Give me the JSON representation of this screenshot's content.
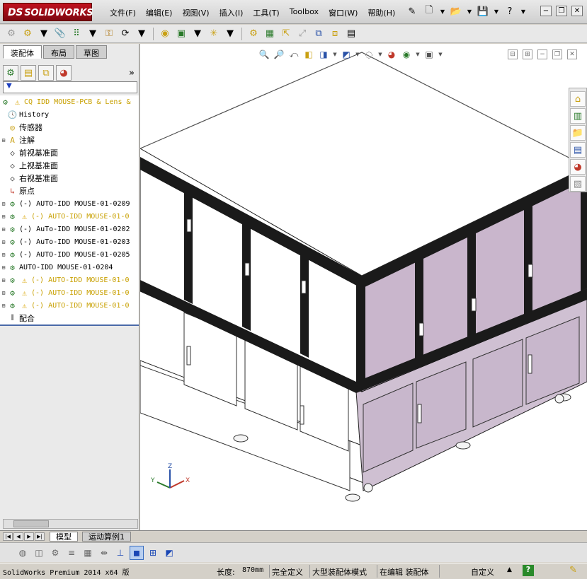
{
  "app": {
    "logo_prefix": "DS",
    "logo_text": "SOLIDWORKS"
  },
  "menu": [
    "文件(F)",
    "编辑(E)",
    "视图(V)",
    "插入(I)",
    "工具(T)",
    "Toolbox",
    "窗口(W)",
    "帮助(H)"
  ],
  "title_toolbar_icons": [
    "pin-icon",
    "new-document-icon",
    "open-icon",
    "save-icon",
    "help-icon"
  ],
  "window_controls": [
    "minimize",
    "restore",
    "close"
  ],
  "main_toolbar_icons": [
    "edit-component-icon",
    "insert-components-icon",
    "mate-icon",
    "linear-pattern-icon",
    "smart-fasteners-icon",
    "move-component-icon",
    "show-hidden-icon",
    "assembly-features-icon",
    "reference-geometry-icon",
    "new-motion-study-icon",
    "bill-of-materials-icon",
    "exploded-view-icon",
    "explode-line-sketch-icon",
    "interference-detection-icon",
    "clearance-verification-icon",
    "hole-alignment-icon",
    "measure-icon"
  ],
  "panel_tabs": [
    "装配体",
    "布局",
    "草图"
  ],
  "feature_tree": {
    "root": "CQ IDD MOUSE-PCB & Lens &",
    "items": [
      {
        "label": "History",
        "icon": "history-icon",
        "expandable": false,
        "warn": false
      },
      {
        "label": "传感器",
        "icon": "sensor-icon",
        "expandable": false,
        "warn": false
      },
      {
        "label": "注解",
        "icon": "annotation-icon",
        "expandable": true,
        "warn": false
      },
      {
        "label": "前视基准面",
        "icon": "plane-icon",
        "expandable": false,
        "warn": false
      },
      {
        "label": "上视基准面",
        "icon": "plane-icon",
        "expandable": false,
        "warn": false
      },
      {
        "label": "右视基准面",
        "icon": "plane-icon",
        "expandable": false,
        "warn": false
      },
      {
        "label": "原点",
        "icon": "origin-icon",
        "expandable": false,
        "warn": false
      },
      {
        "label": "(-) AUTO-IDD MOUSE-01-0209",
        "icon": "subassembly-icon",
        "expandable": true,
        "warn": false
      },
      {
        "label": "(-) AUTO-IDD MOUSE-01-0",
        "icon": "subassembly-icon",
        "expandable": true,
        "warn": true
      },
      {
        "label": "(-) AuTo-IDD MOUSE-01-0202",
        "icon": "subassembly-icon",
        "expandable": true,
        "warn": false
      },
      {
        "label": "(-) AuTo-IDD MOUSE-01-0203",
        "icon": "subassembly-icon",
        "expandable": true,
        "warn": false
      },
      {
        "label": "(-) AUTO-IDD MOUSE-01-0205",
        "icon": "subassembly-icon",
        "expandable": true,
        "warn": false
      },
      {
        "label": "AUTO-IDD MOUSE-01-0204",
        "icon": "subassembly-icon",
        "expandable": true,
        "warn": false
      },
      {
        "label": "(-) AUTO-IDD MOUSE-01-0",
        "icon": "subassembly-icon",
        "expandable": true,
        "warn": true
      },
      {
        "label": "(-) AUTO-IDD MOUSE-01-0",
        "icon": "subassembly-icon",
        "expandable": true,
        "warn": true
      },
      {
        "label": "(-) AUTO-IDD MOUSE-01-0",
        "icon": "subassembly-icon",
        "expandable": true,
        "warn": true
      },
      {
        "label": "配合",
        "icon": "mates-icon",
        "expandable": false,
        "warn": false
      }
    ]
  },
  "bottom_tabs": [
    "模型",
    "运动算例1"
  ],
  "status": {
    "product": "SolidWorks Premium 2014 x64 版",
    "length_label": "长度:",
    "length_value": "870mm",
    "constraint": "完全定义",
    "mode": "大型装配体模式",
    "editing": "在编辑 装配体",
    "units": "自定义",
    "help": "?"
  },
  "triad": {
    "x": "X",
    "y": "Y",
    "z": "Z"
  },
  "colors": {
    "accent": "#1a47b5",
    "enclosure_side": "#c9b6cc",
    "frame": "#1a1a1a"
  }
}
